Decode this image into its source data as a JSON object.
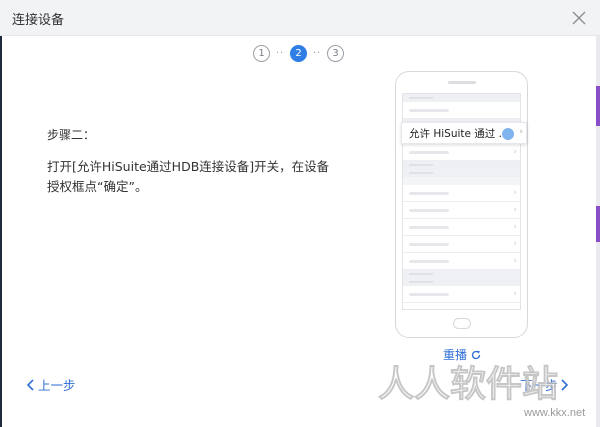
{
  "window": {
    "title": "连接设备"
  },
  "stepper": {
    "steps": [
      "1",
      "2",
      "3"
    ],
    "active_step": 2,
    "dots": "··"
  },
  "content": {
    "step_label": "步骤二：",
    "instruction": "打开[允许HiSuite通过HDB连接设备]开关，在设备授权框点“确定”。"
  },
  "phone": {
    "callout_text": "允许 HiSuite 通过 ..."
  },
  "actions": {
    "replay_label": "重播",
    "prev_label": "上一步",
    "next_label": "下一步"
  },
  "watermark": {
    "text": "人人软件站",
    "url": "www.kkx.net"
  },
  "colors": {
    "accent": "#2f7ee6",
    "link": "#2f6fd6",
    "titlebar": "#f2f3f5"
  },
  "icons": {
    "close": "close-icon",
    "replay": "refresh-icon",
    "prev": "chevron-left-icon",
    "next": "chevron-right-icon"
  }
}
